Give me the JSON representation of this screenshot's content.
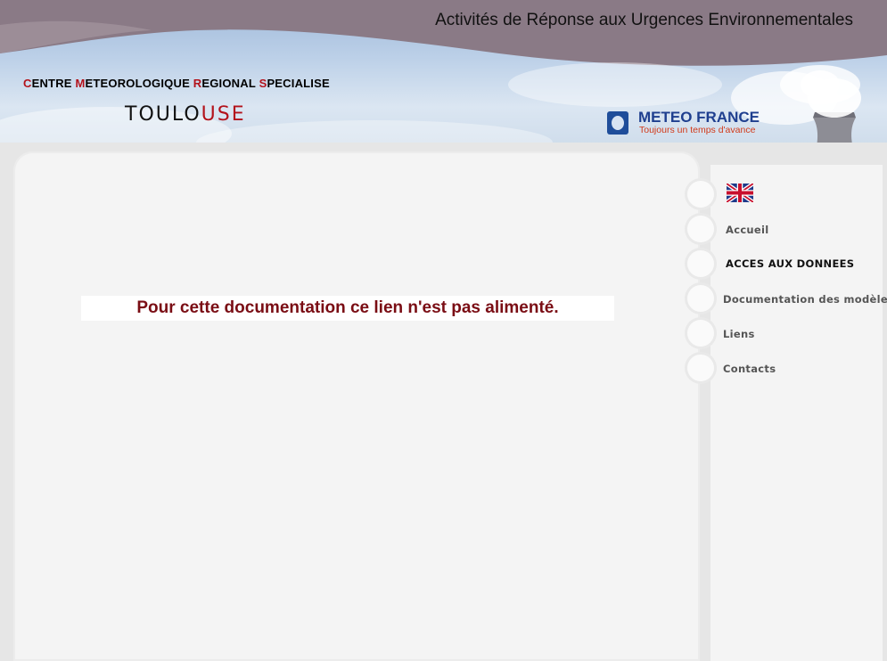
{
  "header": {
    "title": "Activités de Réponse aux Urgences Environnementales",
    "center_name": {
      "w1_init": "C",
      "w1_rest": "ENTRE ",
      "w2_init": "M",
      "w2_rest": "ETEOROLOGIQUE ",
      "w3_init": "R",
      "w3_rest": "EGIONAL ",
      "w4_init": "S",
      "w4_rest": "PECIALISE"
    },
    "city_part1": "TOULO",
    "city_part2": "USE",
    "logo": {
      "name": "METEO FRANCE",
      "tagline": "Toujours un temps d'avance"
    }
  },
  "main": {
    "message": "Pour cette documentation ce lien n'est pas alimenté."
  },
  "nav": {
    "language_flag_icon": "uk-flag-icon",
    "items": [
      {
        "label": "Accueil"
      },
      {
        "label": "ACCES AUX DONNEES"
      },
      {
        "label": "Documentation des modèles"
      },
      {
        "label": "Liens"
      },
      {
        "label": "Contacts"
      }
    ]
  },
  "colors": {
    "accent_red": "#b3121b",
    "message_red": "#7a0d14",
    "logo_blue": "#1f3f8f",
    "header_band": "#8a7a86"
  }
}
